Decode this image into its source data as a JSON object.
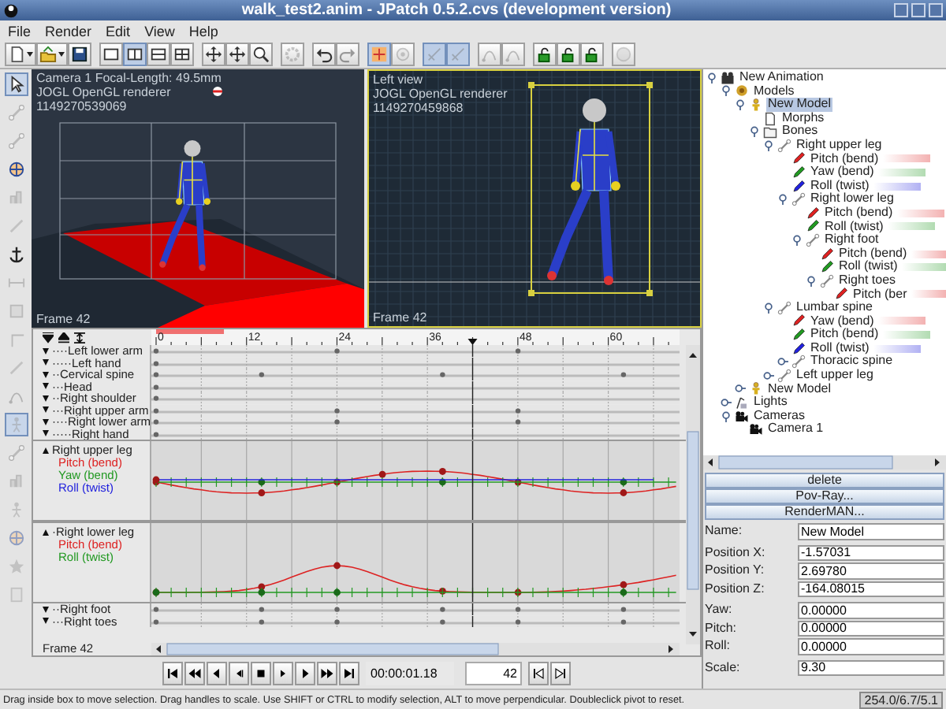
{
  "window": {
    "title": "walk_test2.anim - JPatch 0.5.2.cvs (development version)"
  },
  "menu": [
    {
      "label": "File"
    },
    {
      "label": "Render"
    },
    {
      "label": "Edit"
    },
    {
      "label": "View"
    },
    {
      "label": "Help"
    }
  ],
  "toolbar": [
    [
      {
        "kind": "new",
        "dropdown": true,
        "selected": false,
        "disabled": false
      },
      {
        "kind": "open",
        "dropdown": true,
        "selected": false,
        "disabled": false
      },
      {
        "kind": "save",
        "dropdown": false,
        "selected": false,
        "disabled": false
      }
    ],
    [
      {
        "kind": "layout-single",
        "dropdown": false,
        "selected": false,
        "disabled": false
      },
      {
        "kind": "layout-vertical",
        "dropdown": false,
        "selected": true,
        "disabled": false
      },
      {
        "kind": "layout-horizontal",
        "dropdown": false,
        "selected": false,
        "disabled": false
      },
      {
        "kind": "layout-quad",
        "dropdown": false,
        "selected": false,
        "disabled": false
      }
    ],
    [
      {
        "kind": "move",
        "dropdown": false,
        "selected": false,
        "disabled": false
      },
      {
        "kind": "move",
        "dropdown": false,
        "selected": false,
        "disabled": false
      },
      {
        "kind": "zoom",
        "dropdown": false,
        "selected": false,
        "disabled": false
      }
    ],
    [
      {
        "kind": "gear",
        "dropdown": false,
        "selected": false,
        "disabled": true
      }
    ],
    [
      {
        "kind": "undo",
        "dropdown": false,
        "selected": false,
        "disabled": false
      },
      {
        "kind": "redo",
        "dropdown": false,
        "selected": false,
        "disabled": true
      }
    ],
    [
      {
        "kind": "snap",
        "dropdown": false,
        "selected": true,
        "disabled": false
      },
      {
        "kind": "target",
        "dropdown": false,
        "selected": false,
        "disabled": true
      }
    ],
    [
      {
        "kind": "tangent",
        "dropdown": false,
        "selected": true,
        "disabled": true
      },
      {
        "kind": "tangent",
        "dropdown": false,
        "selected": true,
        "disabled": true
      }
    ],
    [
      {
        "kind": "node",
        "dropdown": false,
        "selected": false,
        "disabled": true
      },
      {
        "kind": "node",
        "dropdown": false,
        "selected": false,
        "disabled": true
      }
    ],
    [
      {
        "kind": "lock",
        "dropdown": false,
        "selected": false,
        "disabled": false
      },
      {
        "kind": "lock",
        "dropdown": false,
        "selected": false,
        "disabled": false
      },
      {
        "kind": "lock",
        "dropdown": false,
        "selected": false,
        "disabled": false
      }
    ],
    [
      {
        "kind": "disc",
        "dropdown": false,
        "selected": false,
        "disabled": true
      }
    ]
  ],
  "tools": [
    {
      "kind": "pointer",
      "selected": true,
      "disabled": false
    },
    {
      "kind": "bone",
      "selected": false,
      "disabled": true
    },
    {
      "kind": "bone",
      "selected": false,
      "disabled": true
    },
    {
      "kind": "globe",
      "selected": false,
      "disabled": false
    },
    {
      "kind": "chart",
      "selected": false,
      "disabled": true
    },
    {
      "kind": "line",
      "selected": false,
      "disabled": true
    },
    {
      "kind": "anchor",
      "selected": false,
      "disabled": false
    },
    {
      "kind": "measure",
      "selected": false,
      "disabled": true
    },
    {
      "kind": "grid",
      "selected": false,
      "disabled": true
    },
    {
      "kind": "corner",
      "selected": false,
      "disabled": true
    },
    {
      "kind": "line",
      "selected": false,
      "disabled": true
    },
    {
      "kind": "node",
      "selected": false,
      "disabled": true
    },
    {
      "kind": "figure",
      "selected": true,
      "disabled": true
    },
    {
      "kind": "bone",
      "selected": false,
      "disabled": true
    },
    {
      "kind": "chart",
      "selected": false,
      "disabled": true
    },
    {
      "kind": "figure",
      "selected": false,
      "disabled": true
    },
    {
      "kind": "globe",
      "selected": false,
      "disabled": true
    },
    {
      "kind": "star",
      "selected": false,
      "disabled": true
    },
    {
      "kind": "page",
      "selected": false,
      "disabled": true
    }
  ],
  "viewports": [
    {
      "kind": "camera",
      "title": "Camera 1 Focal-Length: 49.5mm",
      "renderer": "JOGL OpenGL renderer",
      "id": "1149270539069",
      "frame": "Frame 42"
    },
    {
      "kind": "side",
      "title": "Left view",
      "renderer": "JOGL OpenGL renderer",
      "id": "1149270459868",
      "frame": "Frame 42"
    }
  ],
  "timeline": {
    "ruler": [
      "0",
      "12",
      "24",
      "36",
      "48",
      "60"
    ],
    "tracks": [
      {
        "kind": "row",
        "name": "····Left lower arm",
        "expanded": false,
        "keys": [
          {
            "level": 0
          },
          {
            "level": 0.343
          },
          {
            "level": 0.686
          }
        ]
      },
      {
        "kind": "row",
        "name": "·····Left hand",
        "expanded": false,
        "keys": [
          {
            "level": 0
          }
        ]
      },
      {
        "kind": "row",
        "name": "··Cervical spine",
        "expanded": false,
        "keys": [
          {
            "level": 0
          },
          {
            "level": 0.2
          },
          {
            "level": 0.543
          },
          {
            "level": 0.886
          }
        ]
      },
      {
        "kind": "row",
        "name": "···Head",
        "expanded": false,
        "keys": [
          {
            "level": 0
          }
        ]
      },
      {
        "kind": "row",
        "name": "··Right shoulder",
        "expanded": false,
        "keys": [
          {
            "level": 0
          }
        ]
      },
      {
        "kind": "row",
        "name": "···Right upper arm",
        "expanded": false,
        "keys": [
          {
            "level": 0
          },
          {
            "level": 0.343
          },
          {
            "level": 0.686
          }
        ]
      },
      {
        "kind": "row",
        "name": "····Right lower arm",
        "expanded": false,
        "keys": [
          {
            "level": 0
          },
          {
            "level": 0.343
          },
          {
            "level": 0.686
          }
        ]
      },
      {
        "kind": "row",
        "name": "·····Right hand",
        "expanded": false,
        "keys": [
          {
            "level": 0
          }
        ]
      },
      {
        "kind": "graph",
        "name": "Right upper leg",
        "expanded": true,
        "channels": [
          {
            "name": "Pitch (bend)",
            "color": "#dd2222",
            "keys": [
              {
                "level": 0
              },
              {
                "level": 0.2
              },
              {
                "level": 0.343
              },
              {
                "level": 0.429
              },
              {
                "level": 0.543
              },
              {
                "level": 0.686
              },
              {
                "level": 0.886
              }
            ]
          },
          {
            "name": "Yaw (bend)",
            "color": "#229922",
            "keys": [
              {
                "level": 0.2
              },
              {
                "level": 0.543
              },
              {
                "level": 0.886
              }
            ]
          },
          {
            "name": "Roll (twist)",
            "color": "#2222dd",
            "keys": [
              {
                "level": 0
              }
            ]
          }
        ]
      },
      {
        "kind": "graph",
        "name": "·Right lower leg",
        "expanded": true,
        "channels": [
          {
            "name": "Pitch (bend)",
            "color": "#dd2222",
            "keys": [
              {
                "level": 0
              },
              {
                "level": 0.2
              },
              {
                "level": 0.343
              },
              {
                "level": 0.543
              },
              {
                "level": 0.686
              },
              {
                "level": 0.886
              }
            ]
          },
          {
            "name": "Roll (twist)",
            "color": "#229922",
            "keys": [
              {
                "level": 0
              },
              {
                "level": 0.2
              },
              {
                "level": 0.343
              },
              {
                "level": 0.886
              }
            ]
          }
        ]
      },
      {
        "kind": "row",
        "name": "··Right foot",
        "expanded": false,
        "keys": [
          {
            "level": 0
          },
          {
            "level": 0.2
          },
          {
            "level": 0.343
          },
          {
            "level": 0.543
          },
          {
            "level": 0.686
          },
          {
            "level": 0.886
          }
        ]
      },
      {
        "kind": "row",
        "name": "···Right toes",
        "expanded": false,
        "keys": [
          {
            "level": 0
          },
          {
            "level": 0.2
          },
          {
            "level": 0.343
          },
          {
            "level": 0.543
          },
          {
            "level": 0.686
          },
          {
            "level": 0.886
          }
        ]
      }
    ],
    "frame_label": "Frame 42"
  },
  "playback": {
    "time": "00:00:01.18",
    "frame": "42"
  },
  "tree": [
    {
      "name": "New Animation",
      "kind": "animation",
      "selected": false,
      "expanded": true,
      "children": [
        {
          "name": "Models",
          "kind": "models",
          "selected": false,
          "expanded": true,
          "children": [
            {
              "name": "New Model",
              "kind": "model",
              "selected": true,
              "expanded": true,
              "children": [
                {
                  "name": "Morphs",
                  "kind": "doc",
                  "selected": false
                },
                {
                  "name": "Bones",
                  "kind": "folder",
                  "selected": false,
                  "expanded": true,
                  "children": [
                    {
                      "name": "Right upper leg",
                      "kind": "bone",
                      "selected": false,
                      "expanded": true,
                      "children": [
                        {
                          "name": "Pitch (bend)",
                          "kind": "channel",
                          "color": "#dd2222",
                          "selected": false
                        },
                        {
                          "name": "Yaw (bend)",
                          "kind": "channel",
                          "color": "#229922",
                          "selected": false
                        },
                        {
                          "name": "Roll (twist)",
                          "kind": "channel",
                          "color": "#2222dd",
                          "selected": false
                        },
                        {
                          "name": "Right lower leg",
                          "kind": "bone",
                          "selected": false,
                          "expanded": true,
                          "children": [
                            {
                              "name": "Pitch (bend)",
                              "kind": "channel",
                              "color": "#dd2222",
                              "selected": false
                            },
                            {
                              "name": "Roll (twist)",
                              "kind": "channel",
                              "color": "#229922",
                              "selected": false
                            },
                            {
                              "name": "Right foot",
                              "kind": "bone",
                              "selected": false,
                              "expanded": true,
                              "children": [
                                {
                                  "name": "Pitch (bend)",
                                  "kind": "channel",
                                  "color": "#dd2222",
                                  "selected": false
                                },
                                {
                                  "name": "Roll (twist)",
                                  "kind": "channel",
                                  "color": "#229922",
                                  "selected": false
                                },
                                {
                                  "name": "Right toes",
                                  "kind": "bone",
                                  "selected": false,
                                  "expanded": true,
                                  "children": [
                                    {
                                      "name": "Pitch (ber",
                                      "kind": "channel",
                                      "color": "#dd2222",
                                      "selected": false
                                    }
                                  ]
                                }
                              ]
                            }
                          ]
                        }
                      ]
                    },
                    {
                      "name": "Lumbar spine",
                      "kind": "bone",
                      "selected": false,
                      "expanded": true,
                      "children": [
                        {
                          "name": "Yaw (bend)",
                          "kind": "channel",
                          "color": "#dd2222",
                          "selected": false
                        },
                        {
                          "name": "Pitch (bend)",
                          "kind": "channel",
                          "color": "#229922",
                          "selected": false
                        },
                        {
                          "name": "Roll (twist)",
                          "kind": "channel",
                          "color": "#2222dd",
                          "selected": false
                        },
                        {
                          "name": "Thoracic spine",
                          "kind": "bone",
                          "selected": false,
                          "expanded": false
                        }
                      ]
                    },
                    {
                      "name": "Left upper leg",
                      "kind": "bone",
                      "selected": false,
                      "expanded": false
                    }
                  ]
                }
              ]
            },
            {
              "name": "New Model",
              "kind": "model",
              "selected": false,
              "expanded": false
            }
          ]
        },
        {
          "name": "Lights",
          "kind": "lights",
          "selected": false,
          "expanded": false
        },
        {
          "name": "Cameras",
          "kind": "cameras",
          "selected": false,
          "expanded": true,
          "children": [
            {
              "name": "Camera 1",
              "kind": "camera",
              "selected": false
            }
          ]
        }
      ]
    }
  ],
  "actions": [
    {
      "label": "delete"
    },
    {
      "label": "Pov-Ray..."
    },
    {
      "label": "RenderMAN..."
    }
  ],
  "properties": [
    [
      {
        "label": "Name:",
        "value": "New Model"
      }
    ],
    [
      {
        "label": "Position X:",
        "value": "-1.57031"
      },
      {
        "label": "Position Y:",
        "value": "2.69780"
      },
      {
        "label": "Position Z:",
        "value": "-164.08015"
      }
    ],
    [
      {
        "label": "Yaw:",
        "value": "0.00000"
      },
      {
        "label": "Pitch:",
        "value": "0.00000"
      },
      {
        "label": "Roll:",
        "value": "0.00000"
      }
    ],
    [
      {
        "label": "Scale:",
        "value": "9.30"
      }
    ]
  ],
  "status_bar": {
    "message": "Drag inside box to move selection. Drag handles to scale. Use SHIFT or CTRL to modify selection, ALT to move perpendicular. Doubleclick pivot to reset.",
    "coordinates": "254.0/6.7/5.1"
  }
}
